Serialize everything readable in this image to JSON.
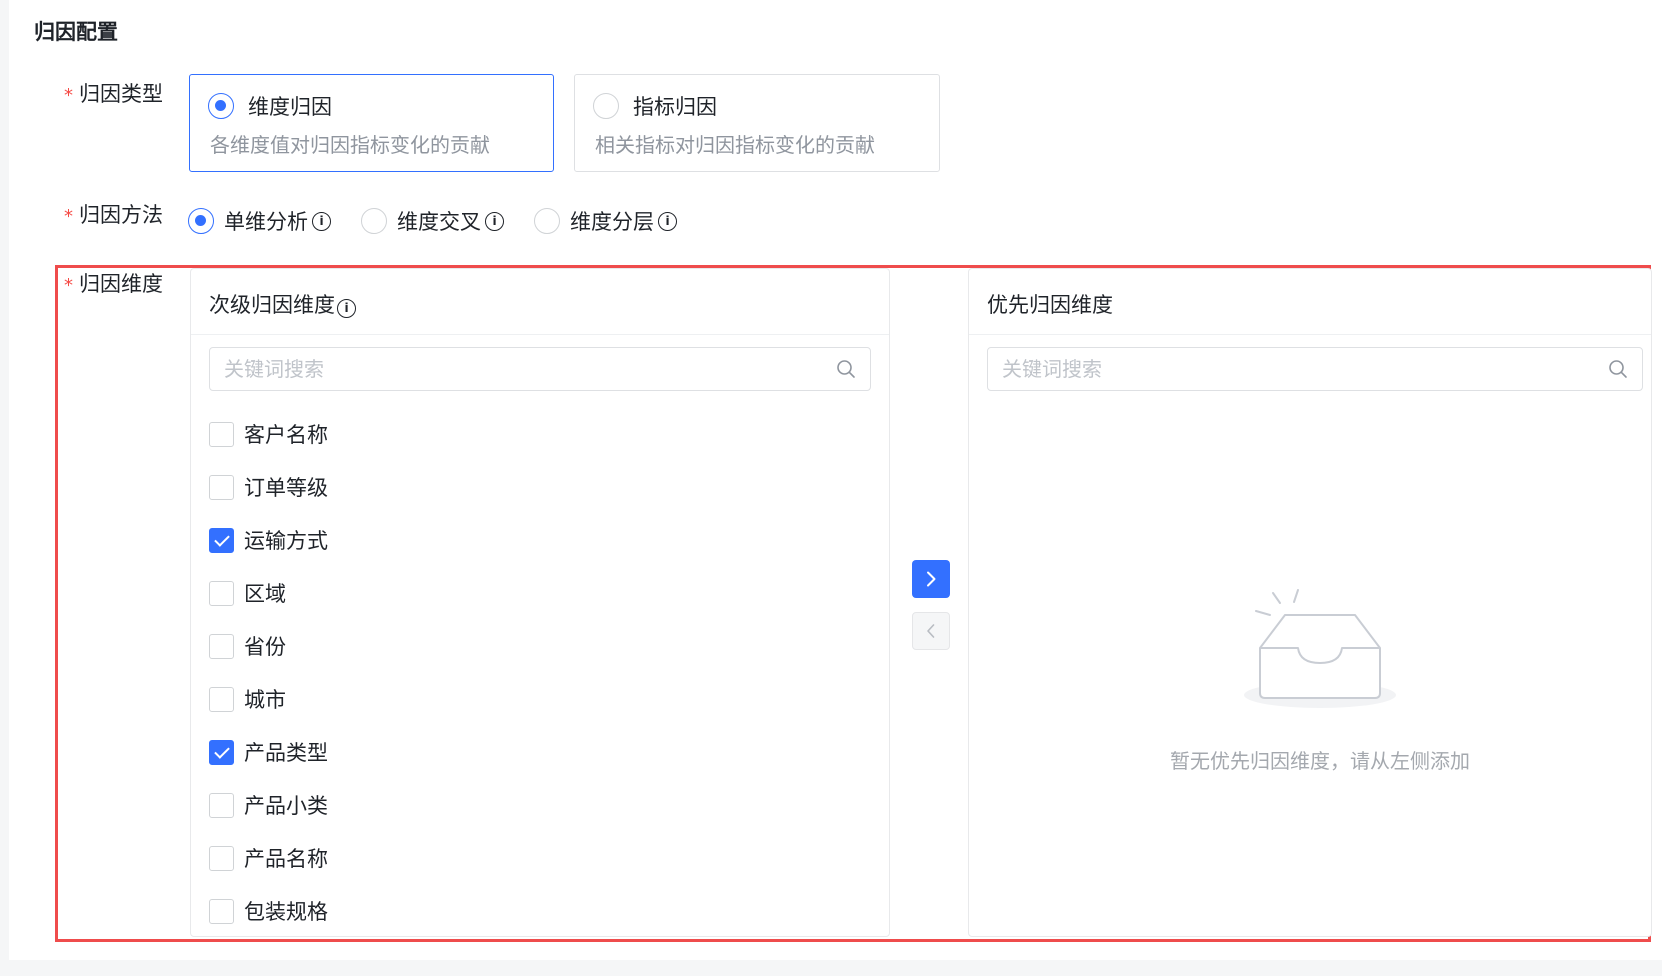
{
  "section": {
    "title": "归因配置"
  },
  "attribution_type": {
    "label": "归因类型",
    "options": [
      {
        "title": "维度归因",
        "desc": "各维度值对归因指标变化的贡献",
        "selected": true
      },
      {
        "title": "指标归因",
        "desc": "相关指标对归因指标变化的贡献",
        "selected": false
      }
    ]
  },
  "attribution_method": {
    "label": "归因方法",
    "options": [
      {
        "label": "单维分析",
        "selected": true
      },
      {
        "label": "维度交叉",
        "selected": false
      },
      {
        "label": "维度分层",
        "selected": false
      }
    ]
  },
  "attribution_dimension": {
    "label": "归因维度",
    "secondary": {
      "title": "次级归因维度",
      "search_placeholder": "关键词搜索",
      "items": [
        {
          "label": "客户名称",
          "checked": false
        },
        {
          "label": "订单等级",
          "checked": false
        },
        {
          "label": "运输方式",
          "checked": true
        },
        {
          "label": "区域",
          "checked": false
        },
        {
          "label": "省份",
          "checked": false
        },
        {
          "label": "城市",
          "checked": false
        },
        {
          "label": "产品类型",
          "checked": true
        },
        {
          "label": "产品小类",
          "checked": false
        },
        {
          "label": "产品名称",
          "checked": false
        },
        {
          "label": "包装规格",
          "checked": false
        }
      ]
    },
    "priority": {
      "title": "优先归因维度",
      "search_placeholder": "关键词搜索",
      "empty_text": "暂无优先归因维度，请从左侧添加"
    }
  },
  "required_mark": "*",
  "info_glyph": "i",
  "colors": {
    "primary": "#3370ff",
    "required": "#f54a45",
    "highlight": "#ef4c4c"
  },
  "icons": {
    "search": "search-icon",
    "info": "info-icon",
    "move_right": "chevron-right-icon",
    "move_left": "chevron-left-icon",
    "empty": "empty-inbox-icon"
  }
}
